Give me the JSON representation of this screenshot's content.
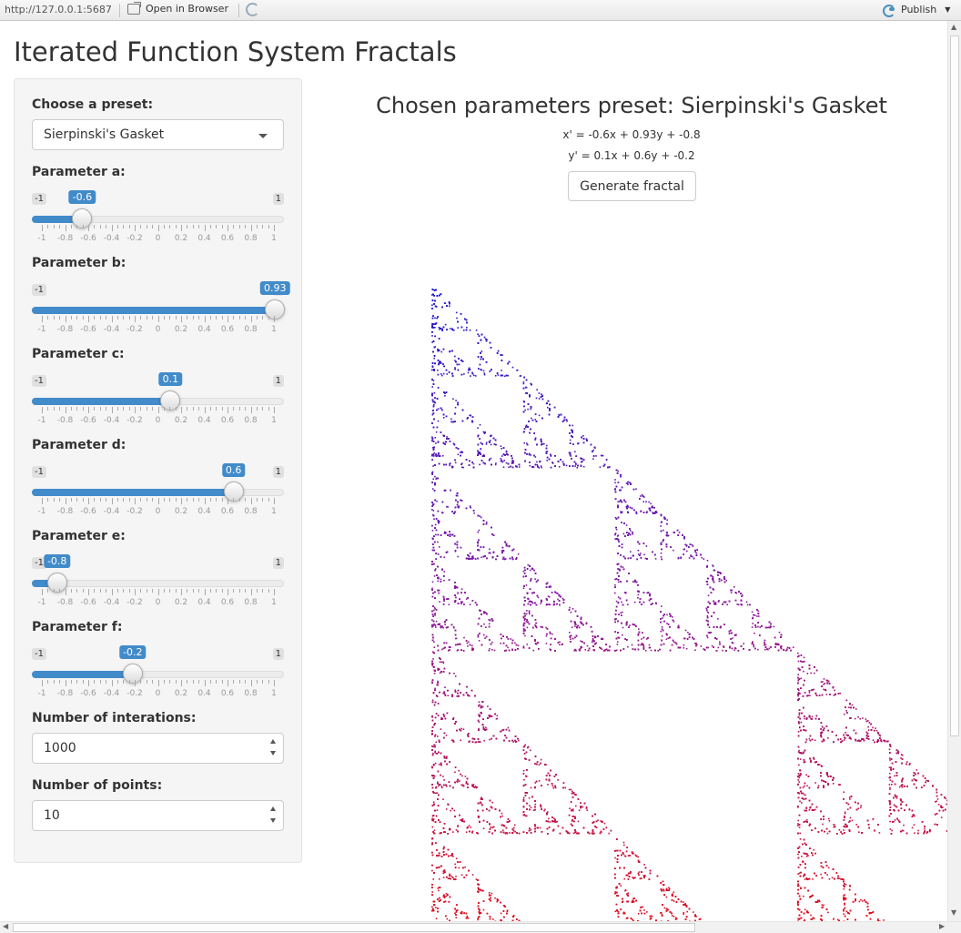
{
  "toolbar": {
    "url": "http://127.0.0.1:5687",
    "open_in_browser": "Open in Browser",
    "publish": "Publish"
  },
  "app": {
    "title": "Iterated Function System Fractals"
  },
  "sidebar": {
    "preset_label": "Choose a preset:",
    "preset_value": "Sierpinski's Gasket",
    "sliders": [
      {
        "label": "Parameter a:",
        "min": "-1",
        "max": "1",
        "value": -0.6,
        "value_label": "-0.6"
      },
      {
        "label": "Parameter b:",
        "min": "-1",
        "max": "1",
        "value": 0.93,
        "value_label": "0.93"
      },
      {
        "label": "Parameter c:",
        "min": "-1",
        "max": "1",
        "value": 0.1,
        "value_label": "0.1"
      },
      {
        "label": "Parameter d:",
        "min": "-1",
        "max": "1",
        "value": 0.6,
        "value_label": "0.6"
      },
      {
        "label": "Parameter e:",
        "min": "-1",
        "max": "1",
        "value": -0.8,
        "value_label": "-0.8"
      },
      {
        "label": "Parameter f:",
        "min": "-1",
        "max": "1",
        "value": -0.2,
        "value_label": "-0.2"
      }
    ],
    "tick_labels": [
      "-1",
      "-0.8",
      "-0.6",
      "-0.4",
      "-0.2",
      "0",
      "0.2",
      "0.4",
      "0.6",
      "0.8",
      "1"
    ],
    "iterations_label": "Number of interations:",
    "iterations_value": "1000",
    "points_label": "Number of points:",
    "points_value": "10"
  },
  "main": {
    "heading": "Chosen parameters preset: Sierpinski's Gasket",
    "eq_x": "x' = -0.6x + 0.93y + -0.8",
    "eq_y": "y' = 0.1x + 0.6y + -0.2",
    "generate_button": "Generate fractal"
  },
  "colors": {
    "accent": "#428bca",
    "fractal_top": "#1a1ad6",
    "fractal_mid": "#8a1aa0",
    "fractal_bottom": "#e0101e"
  }
}
